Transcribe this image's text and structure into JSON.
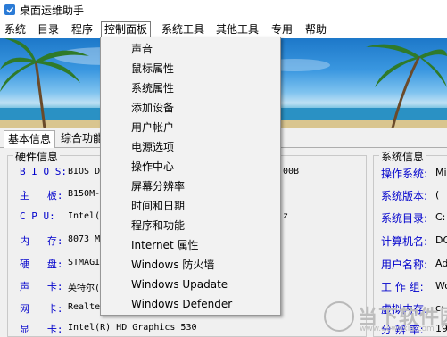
{
  "window": {
    "title": "桌面运维助手"
  },
  "menubar": {
    "items": [
      "系统",
      "目录",
      "程序",
      "控制面板",
      "系统工具",
      "其他工具",
      "专用",
      "帮助"
    ],
    "active_index": 3
  },
  "tabs": [
    "基本信息",
    "综合功能"
  ],
  "hardware": {
    "title": "硬件信息",
    "rows": [
      {
        "label": "B I O S:",
        "value": "BIOS D"
      },
      {
        "label": "主   板:",
        "value": "B150M-"
      },
      {
        "label": "C P U:",
        "value": "Intel("
      },
      {
        "label": "内   存:",
        "value": "8073 M"
      },
      {
        "label": "硬   盘:",
        "value": "STMAGI"
      },
      {
        "label": "声   卡:",
        "value": "英特尔("
      },
      {
        "label": "网   卡:",
        "value": "Realte"
      },
      {
        "label": "显   卡:",
        "value": "Intel(R) HD Graphics 530"
      }
    ],
    "fragments": [
      "00B",
      "z"
    ]
  },
  "system": {
    "title": "系统信息",
    "rows": [
      {
        "label": "操作系统:",
        "value": "Mi"
      },
      {
        "label": "系统版本:",
        "value": "("
      },
      {
        "label": "系统目录:",
        "value": "C:"
      },
      {
        "label": "计算机名:",
        "value": "DO"
      },
      {
        "label": "用户名称:",
        "value": "Ad"
      },
      {
        "label": "工 作 组:",
        "value": "Wo"
      },
      {
        "label": "虚拟内存:",
        "value": "c:"
      },
      {
        "label": "分 辨 率:",
        "value": "19"
      }
    ]
  },
  "control_panel_menu": [
    "声音",
    "鼠标属性",
    "系统属性",
    "添加设备",
    "用户帐户",
    "电源选项",
    "操作中心",
    "屏幕分辨率",
    "时间和日期",
    "程序和功能",
    "Internet 属性",
    "Windows 防火墙",
    "Windows Upadate",
    "Windows Defender"
  ],
  "watermark": {
    "text": "当下软件园",
    "url": "www.downxia.com"
  },
  "colors": {
    "label_blue": "#0000cc",
    "menu_bg": "#f2f2f2",
    "panel_bg": "#f0f0f0"
  }
}
